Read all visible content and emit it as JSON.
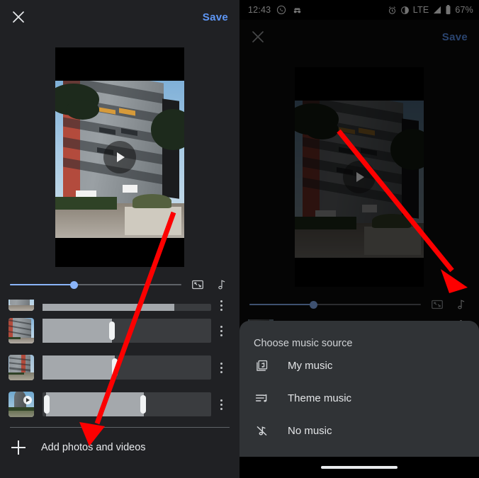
{
  "statusbar": {
    "time": "12:43",
    "icons_left": [
      "whatsapp-icon",
      "incognito-icon"
    ],
    "icons_right": [
      "alarm-icon",
      "dnd-icon",
      "network-type",
      "signal-icon",
      "battery-icon"
    ],
    "network_type": "LTE",
    "battery": "67%"
  },
  "appbar": {
    "close_icon": "close-icon",
    "save_label": "Save"
  },
  "preview": {
    "play_icon": "play-icon",
    "aspect_note": "letterboxed-portrait-video"
  },
  "controls": {
    "slider_value": 37,
    "crop_icon": "crop-resize-icon",
    "music_icon": "music-note-icon"
  },
  "clips": {
    "rows": [
      {
        "thumb": "building-thumb-1",
        "is_video": false,
        "sel_start": 0,
        "sel_end": 41,
        "handles": [
          "right"
        ]
      },
      {
        "thumb": "building-thumb-2",
        "is_video": false,
        "sel_start": 0,
        "sel_end": 43,
        "handles": [
          "right"
        ]
      },
      {
        "thumb": "building-thumb-3",
        "is_video": true,
        "sel_start": 0,
        "sel_end": 60,
        "handles": [
          "left",
          "right"
        ]
      }
    ],
    "kebab_icon": "overflow-menu-icon"
  },
  "add_row": {
    "plus_icon": "plus-icon",
    "label": "Add photos and videos"
  },
  "sheet": {
    "title": "Choose music source",
    "items": [
      {
        "icon": "my-music-icon",
        "label": "My music"
      },
      {
        "icon": "theme-music-icon",
        "label": "Theme music"
      },
      {
        "icon": "no-music-icon",
        "label": "No music"
      }
    ]
  },
  "annotations": {
    "arrow_color": "#fd0000",
    "left_arrow_target": "Add photos and videos",
    "right_arrow_target": "music-note-icon"
  },
  "colors": {
    "accent_blue": "#5e97f6",
    "slider_blue": "#8ab4f8",
    "surface": "#202124",
    "sheet_surface": "#303336"
  }
}
